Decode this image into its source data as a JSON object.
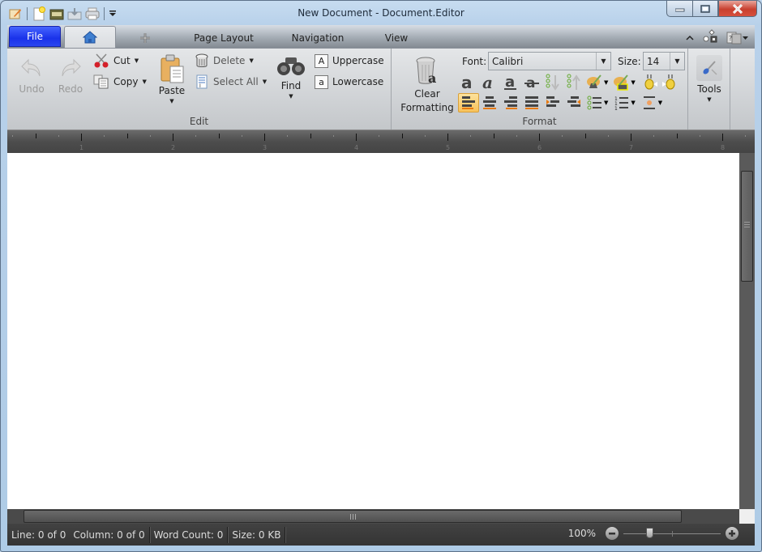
{
  "window": {
    "title": "New Document - Document.Editor",
    "controls": {
      "minimize": "minimize",
      "maximize": "maximize",
      "close": "close"
    }
  },
  "quick_access": {
    "icons": [
      "app-edit-icon",
      "new-document-icon",
      "open-folder-icon",
      "save-icon",
      "print-icon",
      "customize-dropdown-icon"
    ]
  },
  "tabs": {
    "file": "File",
    "home_icon": "home-icon",
    "insert_icon": "insert-plus-icon",
    "page_layout": "Page Layout",
    "navigation": "Navigation",
    "view": "View",
    "active": "home"
  },
  "ribbon": {
    "edit": {
      "label": "Edit",
      "undo": "Undo",
      "redo": "Redo",
      "cut": "Cut",
      "copy": "Copy",
      "paste": "Paste",
      "delete": "Delete",
      "select_all": "Select All",
      "find": "Find",
      "uppercase": "Uppercase",
      "uppercase_glyph": "A",
      "lowercase": "Lowercase",
      "lowercase_glyph": "a"
    },
    "format": {
      "label": "Format",
      "clear_formatting_1": "Clear",
      "clear_formatting_2": "Formatting",
      "font_label": "Font:",
      "font_value": "Calibri",
      "size_label": "Size:",
      "size_value": "14",
      "row1": [
        "bold-icon",
        "italic-icon",
        "underline-icon",
        "strikethrough-icon",
        "sort-descending-icon",
        "sort-ascending-icon",
        "highlight-color-icon",
        "font-color-icon",
        "decrease-spacing-icon",
        "increase-spacing-icon"
      ],
      "row2": [
        "align-left-icon",
        "align-center-icon",
        "align-right-icon",
        "justify-icon",
        "decrease-indent-icon",
        "increase-indent-icon",
        "bullet-list-icon",
        "numbered-list-icon",
        "paragraph-spacing-icon"
      ],
      "active_alignment": "align-left"
    },
    "tools": {
      "label": "Tools"
    }
  },
  "ruler": {
    "labels": [
      "1",
      "2",
      "3",
      "4",
      "5",
      "6",
      "7",
      "8"
    ]
  },
  "document": {
    "content": ""
  },
  "status": {
    "line": "Line: 0 of 0",
    "column": "Column: 0 of 0",
    "word_count": "Word Count: 0",
    "size": "Size: 0 KB",
    "zoom": "100%",
    "zoom_level_percent": 100
  },
  "colors": {
    "file_tab": "#1f3af0",
    "active_highlight": "#f7c25a",
    "status_bar": "#3a3a3a",
    "ruler": "#555555"
  }
}
